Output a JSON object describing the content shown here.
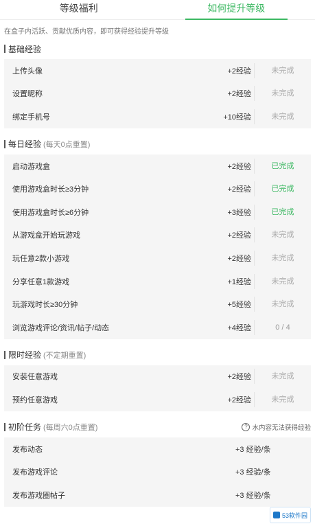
{
  "tabs": [
    {
      "label": "等级福利",
      "active": false
    },
    {
      "label": "如何提升等级",
      "active": true
    }
  ],
  "intro": "在盒子内活跃、贡献优质内容，即可获得经验提升等级",
  "sections": {
    "basic": {
      "title": "基础经验",
      "rows": [
        {
          "name": "上传头像",
          "reward": "+2经验",
          "status": "未完成"
        },
        {
          "name": "设置昵称",
          "reward": "+2经验",
          "status": "未完成"
        },
        {
          "name": "绑定手机号",
          "reward": "+10经验",
          "status": "未完成"
        }
      ]
    },
    "daily": {
      "title": "每日经验",
      "subtitle": "(每天0点重置)",
      "rows": [
        {
          "name": "启动游戏盒",
          "reward": "+2经验",
          "status": "已完成"
        },
        {
          "name": "使用游戏盒时长≥3分钟",
          "reward": "+2经验",
          "status": "已完成"
        },
        {
          "name": "使用游戏盒时长≥6分钟",
          "reward": "+3经验",
          "status": "已完成"
        },
        {
          "name": "从游戏盒开始玩游戏",
          "reward": "+2经验",
          "status": "未完成"
        },
        {
          "name": "玩任意2款小游戏",
          "reward": "+2经验",
          "status": "未完成"
        },
        {
          "name": "分享任意1款游戏",
          "reward": "+1经验",
          "status": "未完成"
        },
        {
          "name": "玩游戏时长≥30分钟",
          "reward": "+5经验",
          "status": "未完成"
        },
        {
          "name": "浏览游戏评论/资讯/帖子/动态",
          "reward": "+4经验",
          "status": "0 / 4"
        }
      ]
    },
    "limited": {
      "title": "限时经验",
      "subtitle": "(不定期重置)",
      "rows": [
        {
          "name": "安装任意游戏",
          "reward": "+2经验",
          "status": "未完成"
        },
        {
          "name": "预约任意游戏",
          "reward": "+2经验",
          "status": "未完成"
        }
      ]
    },
    "advanced": {
      "title": "初阶任务",
      "subtitle": "(每周六0点重置)",
      "note": "水内容无法获得经验",
      "rows": [
        {
          "name": "发布动态",
          "reward": "+3 经验/条"
        },
        {
          "name": "发布游戏评论",
          "reward": "+3 经验/条"
        },
        {
          "name": "发布游戏圈帖子",
          "reward": "+3 经验/条"
        }
      ]
    }
  },
  "watermark": "53软件园",
  "colors": {
    "accent": "#3cb862",
    "muted": "#aaaaaa"
  }
}
